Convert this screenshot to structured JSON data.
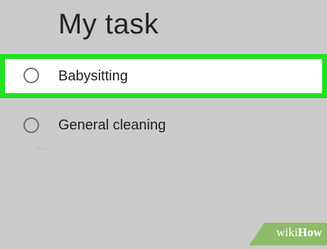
{
  "colors": {
    "background": "#cbcbcb",
    "highlight_border": "#22e022",
    "row_background": "#ffffff",
    "watermark_green": "#8fbc6a"
  },
  "header": {
    "title": "My task"
  },
  "tasks": [
    {
      "label": "Babysitting",
      "checked": false,
      "highlighted": true,
      "icon": "empty-circle-checkbox-icon"
    },
    {
      "label": "General cleaning",
      "checked": false,
      "highlighted": false,
      "icon": "empty-circle-checkbox-icon"
    }
  ],
  "watermark": {
    "wiki": "wiki",
    "how": "How"
  }
}
